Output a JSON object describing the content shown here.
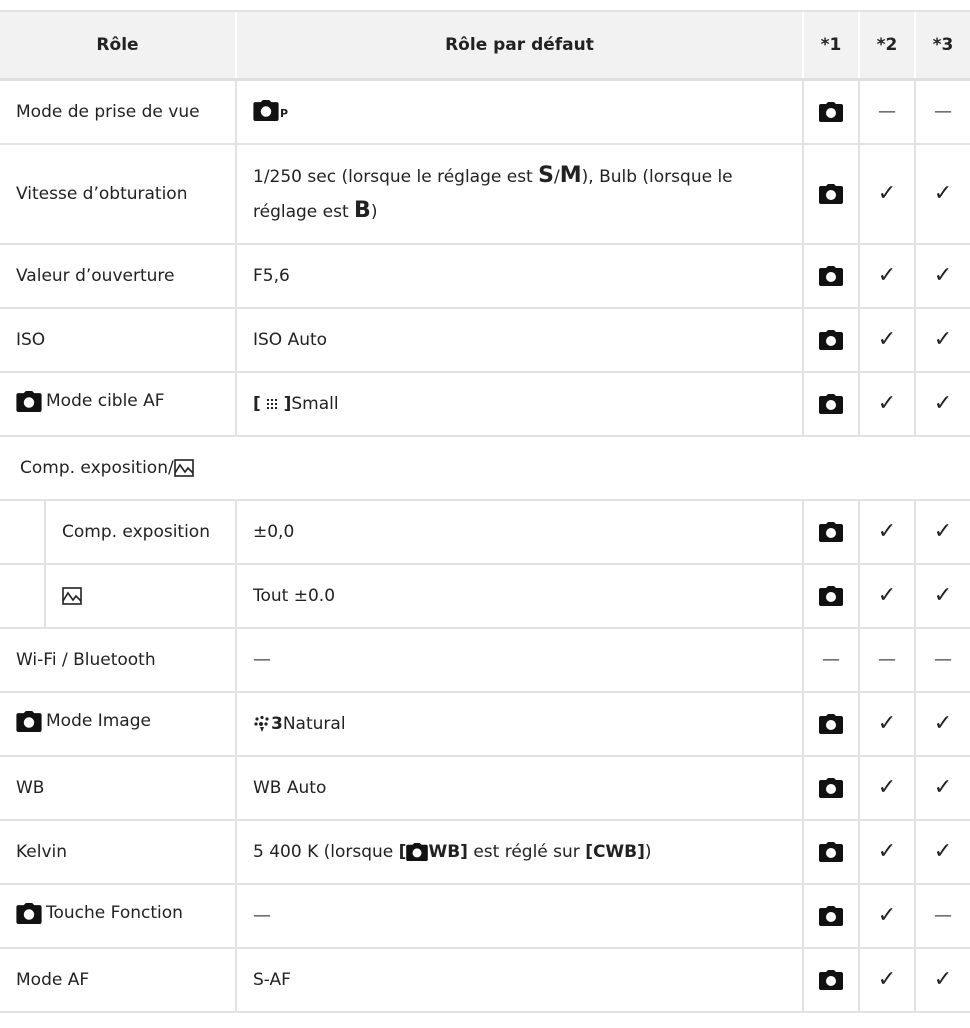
{
  "headers": {
    "role": "Rôle",
    "default": "Rôle par défaut",
    "c1": "*1",
    "c2": "*2",
    "c3": "*3"
  },
  "marks": {
    "tick": "✓",
    "dash": "—"
  },
  "rows": {
    "mode_prise": {
      "role": "Mode de prise de vue",
      "sub": "P"
    },
    "vitesse": {
      "role": "Vitesse d’obturation",
      "p1": "1/250 sec (lorsque le réglage est ",
      "s": "S",
      "slash": "/",
      "m": "M",
      "p2": "), Bulb (lorsque le réglage est ",
      "b": "B",
      "p3": ")"
    },
    "ouverture": {
      "role": "Valeur d’ouverture",
      "value": "F5,6"
    },
    "iso": {
      "role": "ISO",
      "value": "ISO Auto"
    },
    "cible_af": {
      "role": "Mode cible AF",
      "br_open": "[",
      "br_close": "]",
      "value": "Small"
    },
    "comp_group": {
      "role": "Comp. exposition/"
    },
    "comp_exp": {
      "role": "Comp. exposition",
      "value": "±0,0"
    },
    "comp_hl": {
      "value": "Tout ±0.0"
    },
    "wifi": {
      "role": "Wi-Fi / Bluetooth",
      "value": "—"
    },
    "mode_image": {
      "role": "Mode Image",
      "num": "3",
      "value": "Natural"
    },
    "wb": {
      "role": "WB",
      "value": "WB Auto"
    },
    "kelvin": {
      "role": "Kelvin",
      "p1": "5 400 K (lorsque ",
      "b1_open": "[",
      "b1_wb": "WB]",
      "p2": " est réglé sur ",
      "b2": "[CWB]",
      "p3": ")"
    },
    "touche": {
      "role": "Touche Fonction",
      "value": "—"
    },
    "mode_af": {
      "role": "Mode AF",
      "value": "S-AF"
    }
  }
}
